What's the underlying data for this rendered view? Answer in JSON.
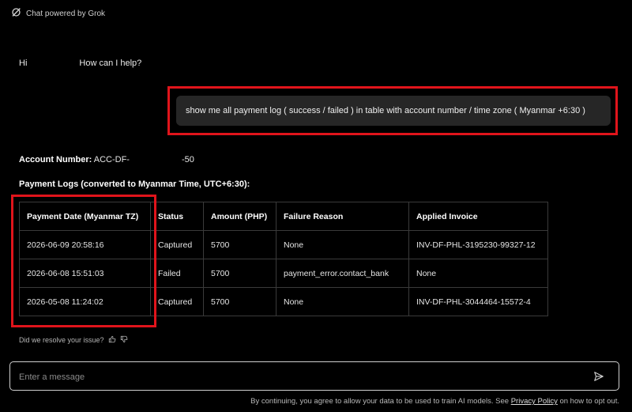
{
  "header": {
    "title": "Chat powered by Grok",
    "icon": "grok-logo-icon"
  },
  "conversation": {
    "greeting_hi": "Hi",
    "greeting_help": "How can I help?",
    "user_message": "show me all payment log ( success / failed ) in table with account number / time zone ( Myanmar +6:30 )",
    "account": {
      "label": "Account Number:",
      "value_prefix": "ACC-DF-",
      "value_suffix": "-50"
    },
    "logs_title": "Payment Logs (converted to Myanmar Time, UTC+6:30):",
    "table": {
      "headers": [
        "Payment Date (Myanmar TZ)",
        "Status",
        "Amount (PHP)",
        "Failure Reason",
        "Applied Invoice"
      ],
      "rows": [
        [
          "2026-06-09 20:58:16",
          "Captured",
          "5700",
          "None",
          "INV-DF-PHL-3195230-99327-12"
        ],
        [
          "2026-06-08 15:51:03",
          "Failed",
          "5700",
          "payment_error.contact_bank",
          "None"
        ],
        [
          "2026-05-08 11:24:02",
          "Captured",
          "5700",
          "None",
          "INV-DF-PHL-3044464-15572-4"
        ]
      ]
    },
    "feedback_prompt": "Did we resolve your issue?"
  },
  "composer": {
    "placeholder": "Enter a message",
    "send_icon": "send-icon"
  },
  "footer": {
    "text_before": "By continuing, you agree to allow your data to be used to train AI models. See",
    "link": "Privacy Policy",
    "text_after": "on how to opt out."
  },
  "colors": {
    "background": "#000000",
    "highlight": "#e0141b",
    "bubble": "#262626"
  }
}
